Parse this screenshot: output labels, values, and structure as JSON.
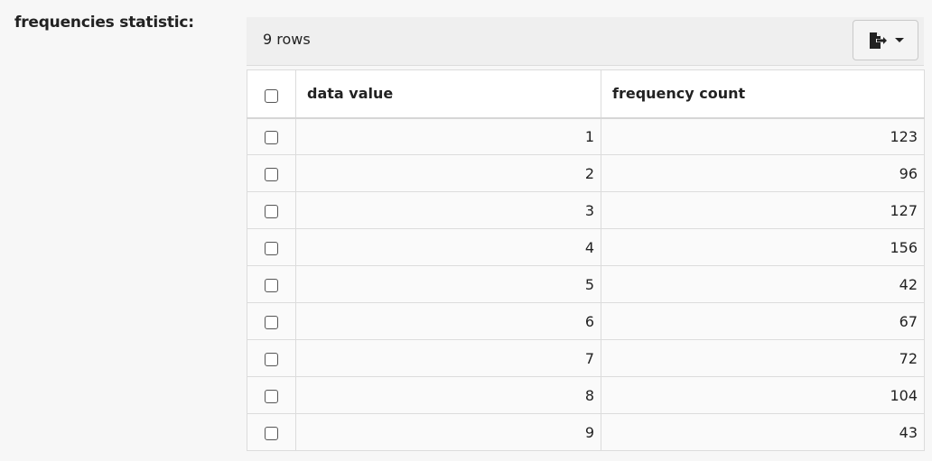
{
  "statistic_label": "frequencies statistic:",
  "toolbar": {
    "row_count": "9 rows",
    "export_icon": "file-export-icon",
    "dropdown_icon": "caret-down-icon"
  },
  "table": {
    "columns": [
      "data value",
      "frequency count"
    ],
    "rows": [
      {
        "value": "1",
        "count": "123"
      },
      {
        "value": "2",
        "count": "96"
      },
      {
        "value": "3",
        "count": "127"
      },
      {
        "value": "4",
        "count": "156"
      },
      {
        "value": "5",
        "count": "42"
      },
      {
        "value": "6",
        "count": "67"
      },
      {
        "value": "7",
        "count": "72"
      },
      {
        "value": "8",
        "count": "104"
      },
      {
        "value": "9",
        "count": "43"
      }
    ]
  }
}
